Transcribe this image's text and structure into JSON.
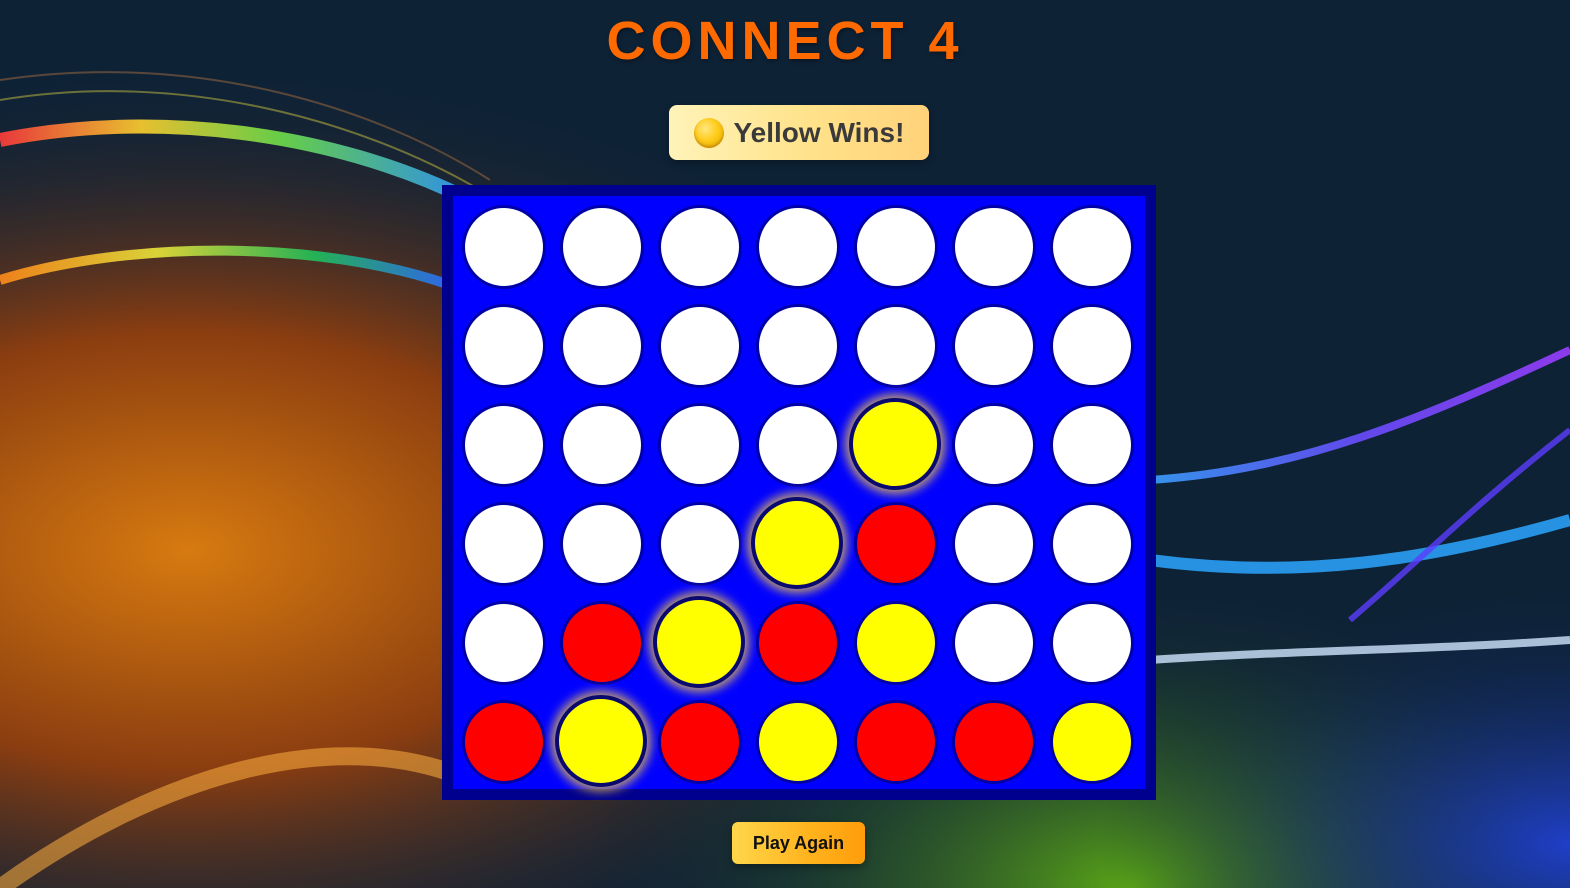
{
  "title": "CONNECT 4",
  "status": {
    "icon": "yellow-circle-icon",
    "text": "Yellow Wins!"
  },
  "board": {
    "rows": 6,
    "cols": 7,
    "cells": [
      [
        "empty",
        "empty",
        "empty",
        "empty",
        "empty",
        "empty",
        "empty"
      ],
      [
        "empty",
        "empty",
        "empty",
        "empty",
        "empty",
        "empty",
        "empty"
      ],
      [
        "empty",
        "empty",
        "empty",
        "empty",
        "yellow",
        "empty",
        "empty"
      ],
      [
        "empty",
        "empty",
        "empty",
        "yellow",
        "red",
        "empty",
        "empty"
      ],
      [
        "empty",
        "red",
        "yellow",
        "red",
        "yellow",
        "empty",
        "empty"
      ],
      [
        "red",
        "yellow",
        "red",
        "yellow",
        "red",
        "red",
        "yellow"
      ]
    ],
    "winning_line": [
      [
        2,
        4
      ],
      [
        3,
        3
      ],
      [
        4,
        2
      ],
      [
        5,
        1
      ]
    ],
    "colors": {
      "board": "#0000ff",
      "frame": "#00008f",
      "empty": "#ffffff",
      "red": "#ff0000",
      "yellow": "#ffff00"
    }
  },
  "actions": {
    "play_again_label": "Play Again"
  },
  "colors": {
    "title": "#ff6a00",
    "button": "#ffb21c"
  }
}
